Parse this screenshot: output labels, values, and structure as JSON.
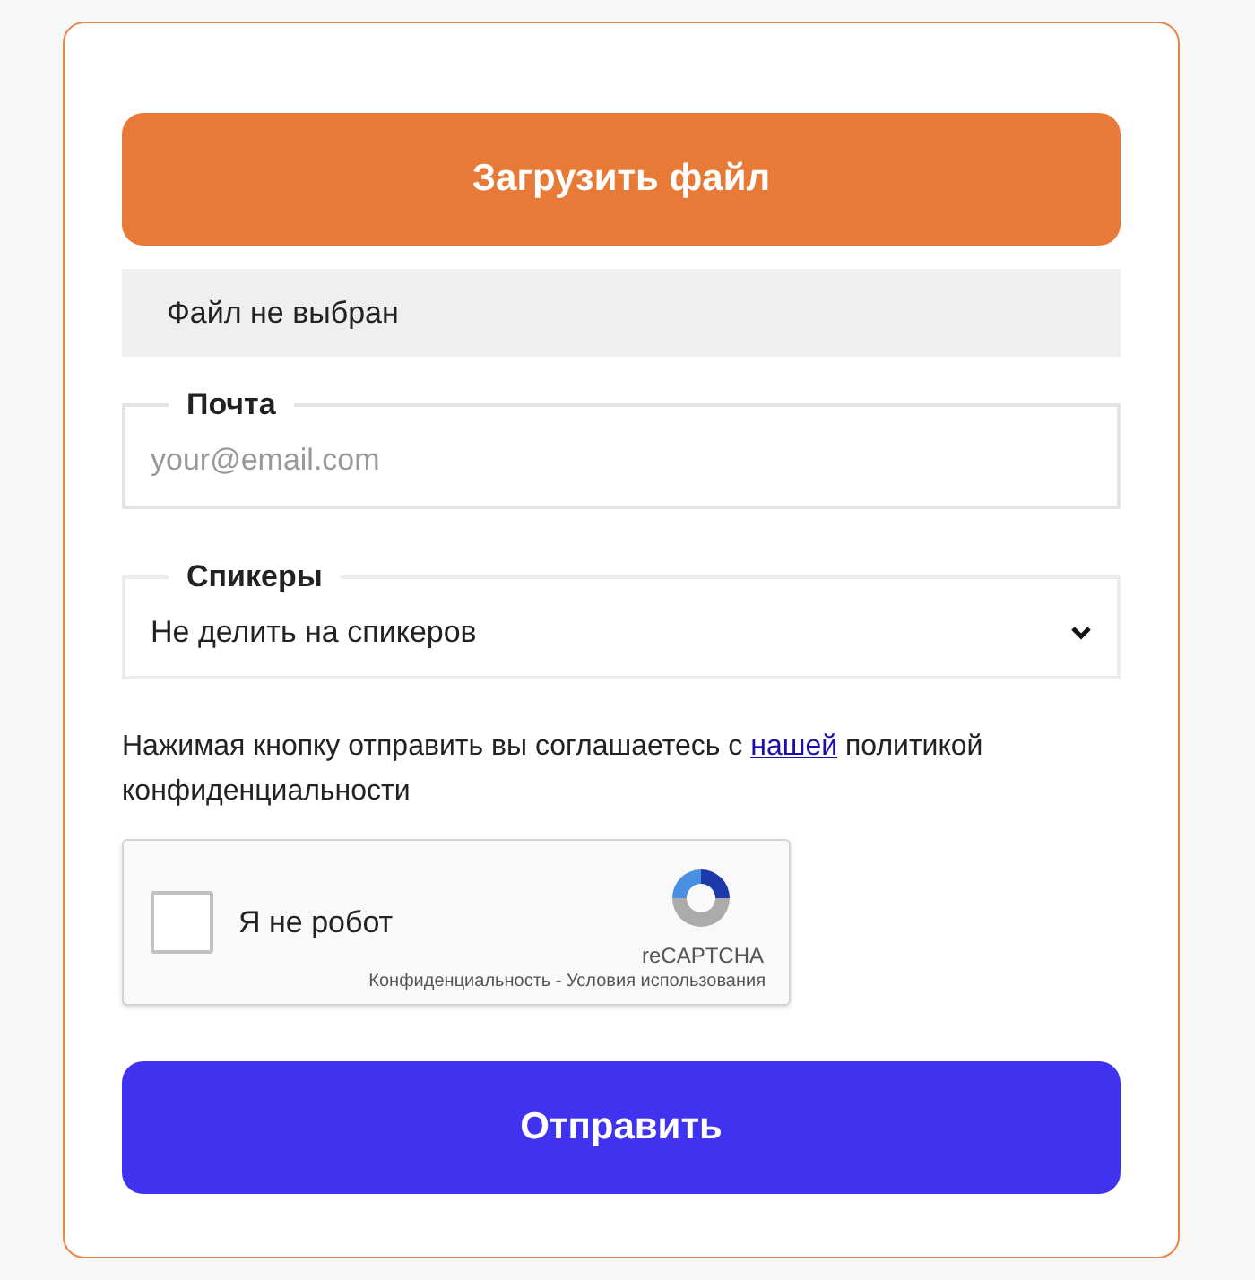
{
  "upload_button": "Загрузить файл",
  "file_status": "Файл не выбран",
  "email": {
    "label": "Почта",
    "placeholder": "your@email.com"
  },
  "speakers": {
    "label": "Спикеры",
    "value": "Не делить на спикеров"
  },
  "consent": {
    "before": "Нажимая кнопку отправить вы соглашаетесь с ",
    "link": "нашей",
    "after": " политикой конфиденциальности"
  },
  "captcha": {
    "label": "Я не робот",
    "checked": false,
    "brand": "reCAPTCHA",
    "links": "Конфиденциальность - Условия использования"
  },
  "submit_button": "Отправить"
}
